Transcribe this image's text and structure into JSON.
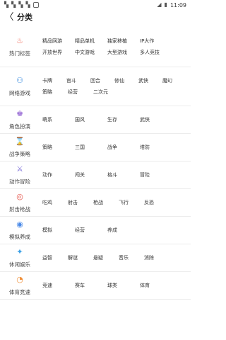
{
  "status_bar": {
    "left_icons": [
      "android-icon",
      "android-icon",
      "android-icon",
      "android-icon",
      "sim-icon"
    ],
    "time": "11:09"
  },
  "header": {
    "title": "分类"
  },
  "categories": [
    {
      "name": "热门标签",
      "icon": "fire-icon",
      "color": "#f06b5a",
      "glyph": "♨",
      "rows": [
        [
          "精品网游",
          "精品单机",
          "独家移植",
          "IP大作"
        ],
        [
          "开放世界",
          "中文游戏",
          "大型游戏",
          "多人竞技"
        ]
      ]
    },
    {
      "name": "网络游戏",
      "icon": "network-icon",
      "color": "#3b8de0",
      "glyph": "⚇",
      "rows": [
        [
          "卡牌",
          "官斗",
          "回合",
          "修仙",
          "武侠",
          "魔幻"
        ],
        [
          "策略",
          "经营",
          "二次元"
        ]
      ]
    },
    {
      "name": "角色扮演",
      "icon": "role-icon",
      "color": "#9b6fd6",
      "glyph": "♚",
      "rows": [
        [
          "萌系",
          "国风",
          "生存",
          "武侠"
        ]
      ]
    },
    {
      "name": "战争策略",
      "icon": "hourglass-icon",
      "color": "#e0554a",
      "glyph": "⌛",
      "rows": [
        [
          "策略",
          "三国",
          "战争",
          "塔防"
        ]
      ]
    },
    {
      "name": "动作冒险",
      "icon": "sword-icon",
      "color": "#7a6cd8",
      "glyph": "⚔",
      "rows": [
        [
          "动作",
          "闯关",
          "格斗",
          "冒险"
        ]
      ]
    },
    {
      "name": "射击枪战",
      "icon": "target-icon",
      "color": "#e6564d",
      "glyph": "◎",
      "rows": [
        [
          "吃鸡",
          "射击",
          "枪战",
          "飞行",
          "反恐"
        ]
      ]
    },
    {
      "name": "模拟养成",
      "icon": "simulation-icon",
      "color": "#4c8be8",
      "glyph": "◉",
      "rows": [
        [
          "模拟",
          "经营",
          "养成"
        ]
      ]
    },
    {
      "name": "休闲娱乐",
      "icon": "casual-icon",
      "color": "#3aa0e6",
      "glyph": "✦",
      "rows": [
        [
          "益智",
          "解谜",
          "悬疑",
          "音乐",
          "消除"
        ]
      ]
    },
    {
      "name": "体育竞速",
      "icon": "speed-icon",
      "color": "#f0903a",
      "glyph": "◔",
      "rows": [
        [
          "竞速",
          "赛车",
          "球类",
          "体育"
        ]
      ]
    }
  ]
}
